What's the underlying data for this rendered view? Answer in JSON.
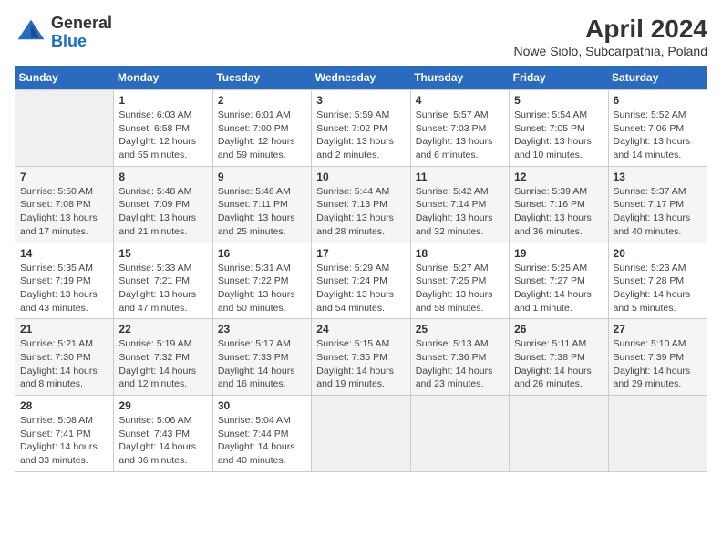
{
  "logo": {
    "line1": "General",
    "line2": "Blue"
  },
  "title": "April 2024",
  "subtitle": "Nowe Siolo, Subcarpathia, Poland",
  "days_of_week": [
    "Sunday",
    "Monday",
    "Tuesday",
    "Wednesday",
    "Thursday",
    "Friday",
    "Saturday"
  ],
  "weeks": [
    [
      {
        "day": "",
        "sunrise": "",
        "sunset": "",
        "daylight": "",
        "empty": true
      },
      {
        "day": "1",
        "sunrise": "Sunrise: 6:03 AM",
        "sunset": "Sunset: 6:58 PM",
        "daylight": "Daylight: 12 hours and 55 minutes."
      },
      {
        "day": "2",
        "sunrise": "Sunrise: 6:01 AM",
        "sunset": "Sunset: 7:00 PM",
        "daylight": "Daylight: 12 hours and 59 minutes."
      },
      {
        "day": "3",
        "sunrise": "Sunrise: 5:59 AM",
        "sunset": "Sunset: 7:02 PM",
        "daylight": "Daylight: 13 hours and 2 minutes."
      },
      {
        "day": "4",
        "sunrise": "Sunrise: 5:57 AM",
        "sunset": "Sunset: 7:03 PM",
        "daylight": "Daylight: 13 hours and 6 minutes."
      },
      {
        "day": "5",
        "sunrise": "Sunrise: 5:54 AM",
        "sunset": "Sunset: 7:05 PM",
        "daylight": "Daylight: 13 hours and 10 minutes."
      },
      {
        "day": "6",
        "sunrise": "Sunrise: 5:52 AM",
        "sunset": "Sunset: 7:06 PM",
        "daylight": "Daylight: 13 hours and 14 minutes."
      }
    ],
    [
      {
        "day": "7",
        "sunrise": "Sunrise: 5:50 AM",
        "sunset": "Sunset: 7:08 PM",
        "daylight": "Daylight: 13 hours and 17 minutes."
      },
      {
        "day": "8",
        "sunrise": "Sunrise: 5:48 AM",
        "sunset": "Sunset: 7:09 PM",
        "daylight": "Daylight: 13 hours and 21 minutes."
      },
      {
        "day": "9",
        "sunrise": "Sunrise: 5:46 AM",
        "sunset": "Sunset: 7:11 PM",
        "daylight": "Daylight: 13 hours and 25 minutes."
      },
      {
        "day": "10",
        "sunrise": "Sunrise: 5:44 AM",
        "sunset": "Sunset: 7:13 PM",
        "daylight": "Daylight: 13 hours and 28 minutes."
      },
      {
        "day": "11",
        "sunrise": "Sunrise: 5:42 AM",
        "sunset": "Sunset: 7:14 PM",
        "daylight": "Daylight: 13 hours and 32 minutes."
      },
      {
        "day": "12",
        "sunrise": "Sunrise: 5:39 AM",
        "sunset": "Sunset: 7:16 PM",
        "daylight": "Daylight: 13 hours and 36 minutes."
      },
      {
        "day": "13",
        "sunrise": "Sunrise: 5:37 AM",
        "sunset": "Sunset: 7:17 PM",
        "daylight": "Daylight: 13 hours and 40 minutes."
      }
    ],
    [
      {
        "day": "14",
        "sunrise": "Sunrise: 5:35 AM",
        "sunset": "Sunset: 7:19 PM",
        "daylight": "Daylight: 13 hours and 43 minutes."
      },
      {
        "day": "15",
        "sunrise": "Sunrise: 5:33 AM",
        "sunset": "Sunset: 7:21 PM",
        "daylight": "Daylight: 13 hours and 47 minutes."
      },
      {
        "day": "16",
        "sunrise": "Sunrise: 5:31 AM",
        "sunset": "Sunset: 7:22 PM",
        "daylight": "Daylight: 13 hours and 50 minutes."
      },
      {
        "day": "17",
        "sunrise": "Sunrise: 5:29 AM",
        "sunset": "Sunset: 7:24 PM",
        "daylight": "Daylight: 13 hours and 54 minutes."
      },
      {
        "day": "18",
        "sunrise": "Sunrise: 5:27 AM",
        "sunset": "Sunset: 7:25 PM",
        "daylight": "Daylight: 13 hours and 58 minutes."
      },
      {
        "day": "19",
        "sunrise": "Sunrise: 5:25 AM",
        "sunset": "Sunset: 7:27 PM",
        "daylight": "Daylight: 14 hours and 1 minute."
      },
      {
        "day": "20",
        "sunrise": "Sunrise: 5:23 AM",
        "sunset": "Sunset: 7:28 PM",
        "daylight": "Daylight: 14 hours and 5 minutes."
      }
    ],
    [
      {
        "day": "21",
        "sunrise": "Sunrise: 5:21 AM",
        "sunset": "Sunset: 7:30 PM",
        "daylight": "Daylight: 14 hours and 8 minutes."
      },
      {
        "day": "22",
        "sunrise": "Sunrise: 5:19 AM",
        "sunset": "Sunset: 7:32 PM",
        "daylight": "Daylight: 14 hours and 12 minutes."
      },
      {
        "day": "23",
        "sunrise": "Sunrise: 5:17 AM",
        "sunset": "Sunset: 7:33 PM",
        "daylight": "Daylight: 14 hours and 16 minutes."
      },
      {
        "day": "24",
        "sunrise": "Sunrise: 5:15 AM",
        "sunset": "Sunset: 7:35 PM",
        "daylight": "Daylight: 14 hours and 19 minutes."
      },
      {
        "day": "25",
        "sunrise": "Sunrise: 5:13 AM",
        "sunset": "Sunset: 7:36 PM",
        "daylight": "Daylight: 14 hours and 23 minutes."
      },
      {
        "day": "26",
        "sunrise": "Sunrise: 5:11 AM",
        "sunset": "Sunset: 7:38 PM",
        "daylight": "Daylight: 14 hours and 26 minutes."
      },
      {
        "day": "27",
        "sunrise": "Sunrise: 5:10 AM",
        "sunset": "Sunset: 7:39 PM",
        "daylight": "Daylight: 14 hours and 29 minutes."
      }
    ],
    [
      {
        "day": "28",
        "sunrise": "Sunrise: 5:08 AM",
        "sunset": "Sunset: 7:41 PM",
        "daylight": "Daylight: 14 hours and 33 minutes."
      },
      {
        "day": "29",
        "sunrise": "Sunrise: 5:06 AM",
        "sunset": "Sunset: 7:43 PM",
        "daylight": "Daylight: 14 hours and 36 minutes."
      },
      {
        "day": "30",
        "sunrise": "Sunrise: 5:04 AM",
        "sunset": "Sunset: 7:44 PM",
        "daylight": "Daylight: 14 hours and 40 minutes."
      },
      {
        "day": "",
        "sunrise": "",
        "sunset": "",
        "daylight": "",
        "empty": true
      },
      {
        "day": "",
        "sunrise": "",
        "sunset": "",
        "daylight": "",
        "empty": true
      },
      {
        "day": "",
        "sunrise": "",
        "sunset": "",
        "daylight": "",
        "empty": true
      },
      {
        "day": "",
        "sunrise": "",
        "sunset": "",
        "daylight": "",
        "empty": true
      }
    ]
  ]
}
